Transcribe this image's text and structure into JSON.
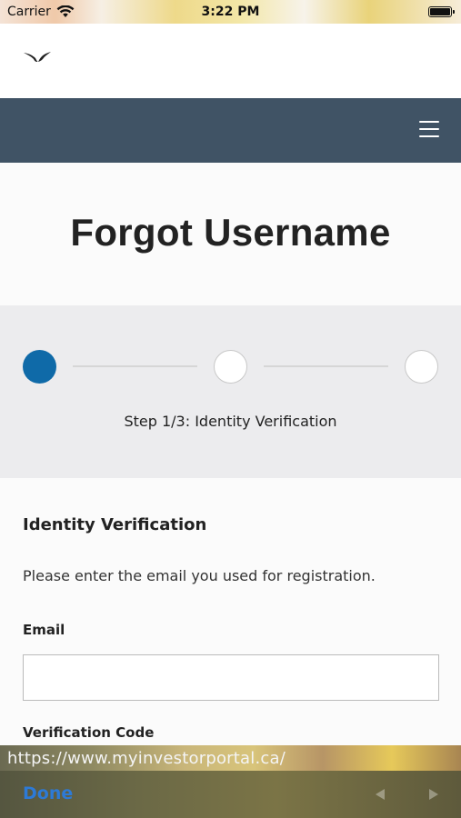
{
  "status_bar": {
    "carrier": "Carrier",
    "time": "3:22 PM",
    "icons": [
      "wifi-icon",
      "battery-icon"
    ]
  },
  "header": {
    "logo_icon": "bird-logo-icon",
    "menu_icon": "hamburger-menu-icon",
    "nav_color": "#405365"
  },
  "page": {
    "title": "Forgot Username"
  },
  "stepper": {
    "active_color": "#0f6aa8",
    "steps_total": 3,
    "current_step": 1,
    "label": "Step 1/3: Identity Verification"
  },
  "form": {
    "section_title": "Identity Verification",
    "instruction": "Please enter the email you used for registration.",
    "email_label": "Email",
    "email_value": "",
    "email_placeholder": "",
    "code_label": "Verification Code"
  },
  "keyboard_toolbar": {
    "url": "https://www.myinvestorportal.ca/",
    "done_label": "Done",
    "done_color": "#2d7ad6",
    "nav_icons": [
      "prev-arrow-icon",
      "next-arrow-icon"
    ]
  }
}
